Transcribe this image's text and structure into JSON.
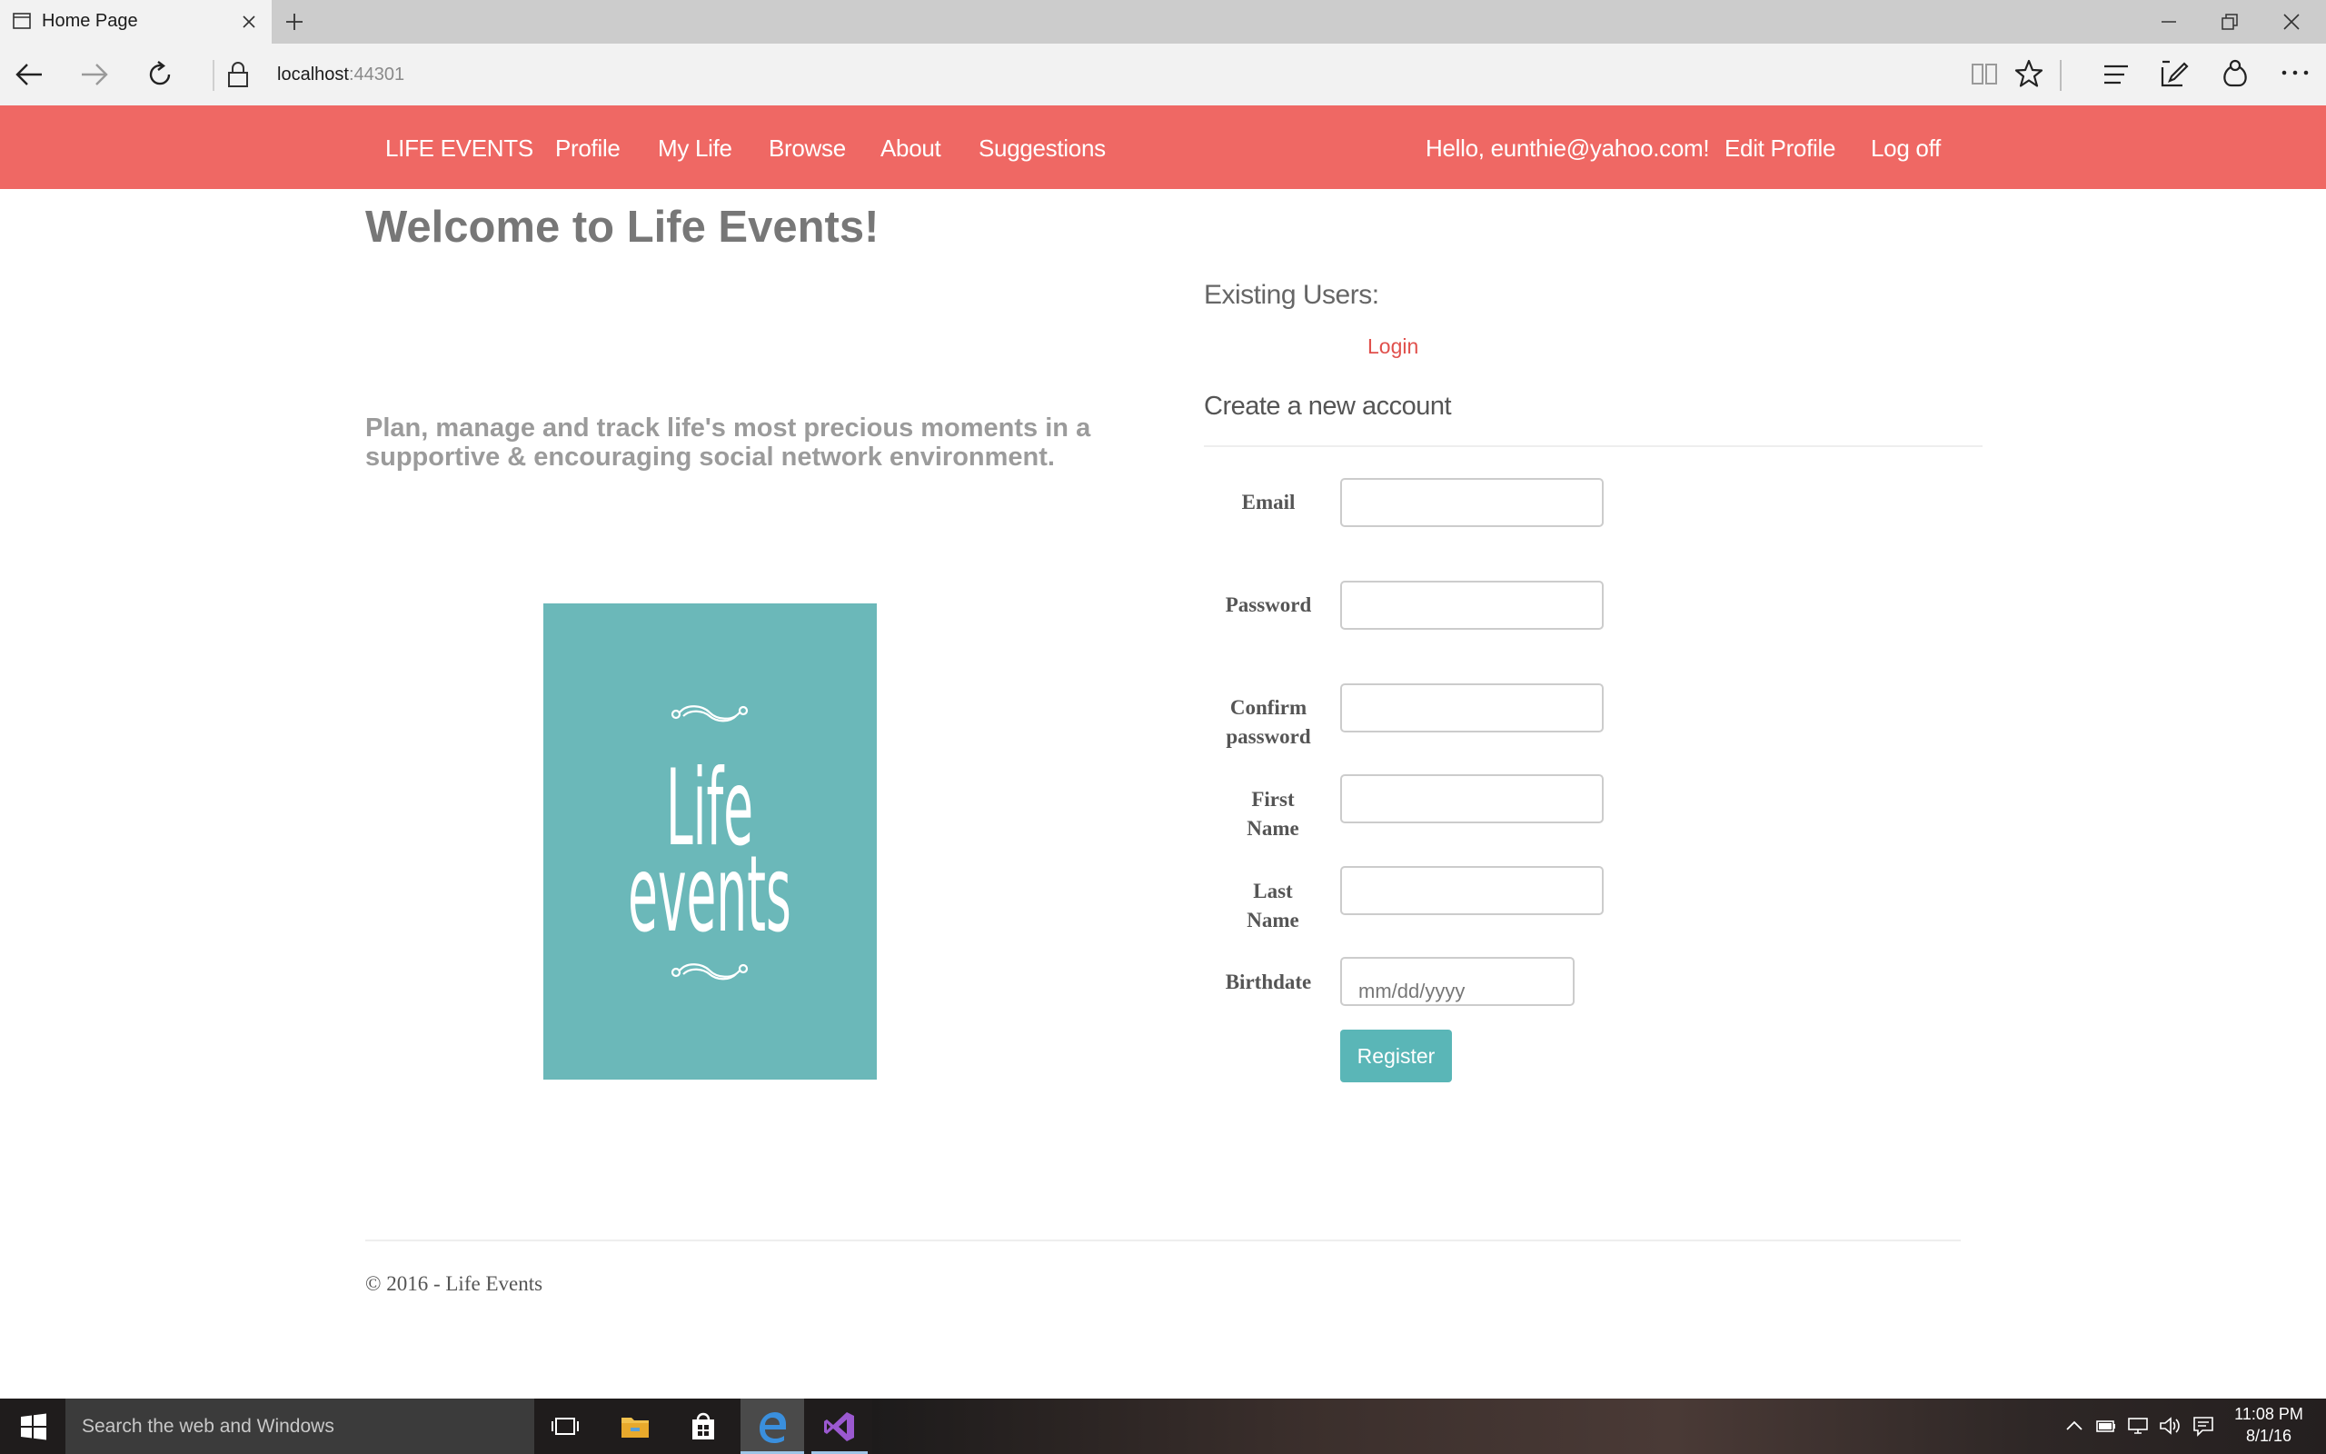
{
  "browser": {
    "tab_title": "Home Page",
    "url_host": "localhost",
    "url_port": ":44301"
  },
  "nav": {
    "brand": "LIFE EVENTS",
    "items": [
      "Profile",
      "My Life",
      "Browse",
      "About",
      "Suggestions"
    ],
    "greeting": "Hello, eunthie@yahoo.com!",
    "edit_profile": "Edit Profile",
    "log_off": "Log off"
  },
  "main": {
    "welcome": "Welcome to Life Events!",
    "tagline": "Plan, manage and track life's most precious moments in a supportive & encouraging social network environment.",
    "logo_line1": "Life",
    "logo_line2": "events"
  },
  "auth": {
    "existing_users": "Existing Users:",
    "login": "Login",
    "create_account": "Create a new account",
    "fields": {
      "email": "Email",
      "password": "Password",
      "confirm_password_1": "Confirm",
      "confirm_password_2": "password",
      "first_name_1": "First",
      "first_name_2": "Name",
      "last_name_1": "Last",
      "last_name_2": "Name",
      "birthdate": "Birthdate",
      "birthdate_placeholder": "mm/dd/yyyy"
    },
    "register": "Register"
  },
  "footer": {
    "text": "© 2016 - Life Events"
  },
  "taskbar": {
    "search_placeholder": "Search the web and Windows",
    "time": "11:08 PM",
    "date": "8/1/16"
  },
  "colors": {
    "navbar": "#ef6864",
    "logo_bg": "#6bb8b9",
    "register_button": "#5ab6b7",
    "link": "#e0504c"
  }
}
